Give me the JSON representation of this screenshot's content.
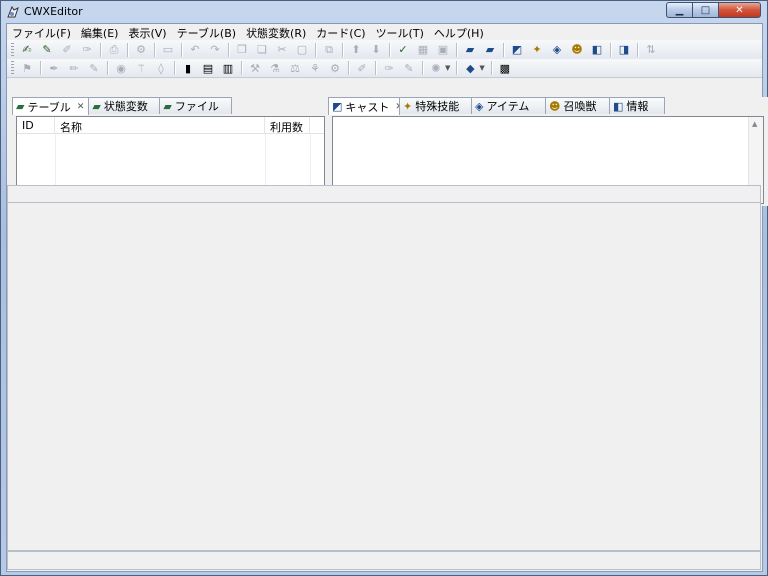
{
  "window": {
    "title": "CWXEditor"
  },
  "menu": [
    "ファイル(F)",
    "編集(E)",
    "表示(V)",
    "テーブル(B)",
    "状態変数(R)",
    "カード(C)",
    "ツール(T)",
    "ヘルプ(H)"
  ],
  "left_tabs": [
    {
      "label": "テーブル",
      "icon": "table-icon",
      "active": true,
      "closable": true
    },
    {
      "label": "状態変数",
      "icon": "variable-icon",
      "active": false,
      "closable": false
    },
    {
      "label": "ファイル",
      "icon": "file-icon",
      "active": false,
      "closable": false
    }
  ],
  "table_columns": [
    "ID",
    "名称",
    "利用数"
  ],
  "right_tabs": [
    {
      "label": "キャスト",
      "icon": "cast-icon",
      "active": true,
      "closable": true
    },
    {
      "label": "特殊技能",
      "icon": "skill-icon",
      "active": false,
      "closable": false
    },
    {
      "label": "アイテム",
      "icon": "item-icon",
      "active": false,
      "closable": false
    },
    {
      "label": "召喚獣",
      "icon": "beast-icon",
      "active": false,
      "closable": false
    },
    {
      "label": "情報",
      "icon": "info-icon",
      "active": false,
      "closable": false
    }
  ],
  "caption_buttons": {
    "minimize": "▁",
    "maximize": "□",
    "close": "✕"
  },
  "colors": {
    "title_gradient": "#b6c9e6",
    "client_bg": "#f0f0f0",
    "close_button": "#c2381e"
  }
}
